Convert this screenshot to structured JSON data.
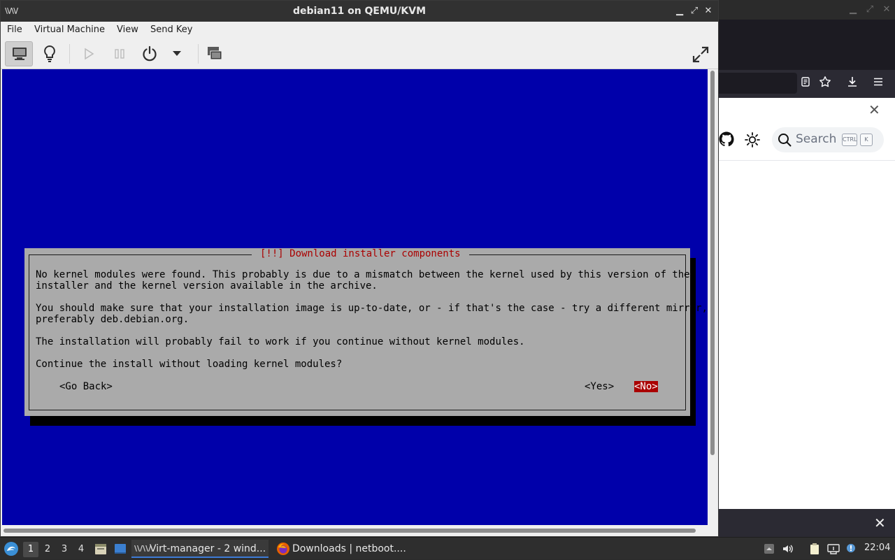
{
  "vm_window": {
    "title": "debian11 on QEMU/KVM",
    "app_icon_text": "\\\\/\\\\/",
    "controls": {
      "minimize": "▁",
      "maximize": "⤢",
      "close": "✕"
    },
    "menu": [
      "File",
      "Virtual Machine",
      "View",
      "Send Key"
    ],
    "toolbar": {
      "items": [
        "console-view",
        "details-view",
        "run",
        "pause",
        "shutdown",
        "shutdown-menu",
        "snapshots",
        "fullscreen"
      ]
    }
  },
  "installer_dialog": {
    "title": "[!!] Download installer components",
    "paragraphs": [
      "No kernel modules were found. This probably is due to a mismatch between the kernel used by this version of the\ninstaller and the kernel version available in the archive.",
      "You should make sure that your installation image is up-to-date, or - if that's the case - try a different mirror,\npreferably deb.debian.org.",
      "The installation will probably fail to work if you continue without kernel modules.",
      "Continue the install without loading kernel modules?"
    ],
    "buttons": {
      "go_back": "<Go Back>",
      "yes": "<Yes>",
      "no": "<No>"
    },
    "selected_button": "no",
    "colors": {
      "background": "#0000aa",
      "dialog": "#aaaaaa",
      "title": "#aa0000",
      "selected": "#aa0000"
    }
  },
  "background_browser": {
    "window_controls": [
      "▁",
      "⤢",
      "✕"
    ],
    "search_placeholder": "Search",
    "kbd_ctrl": "CTRL",
    "kbd_k": "K",
    "close_glyph": "✕"
  },
  "taskbar": {
    "workspaces": [
      "1",
      "2",
      "3",
      "4"
    ],
    "active_workspace": "1",
    "tasks": [
      {
        "label": "Virt-manager - 2 wind...",
        "icon": "virt-manager-icon",
        "active": true
      },
      {
        "label": "Downloads | netboot....",
        "icon": "firefox-icon",
        "active": false
      }
    ],
    "clock": "22:04"
  }
}
